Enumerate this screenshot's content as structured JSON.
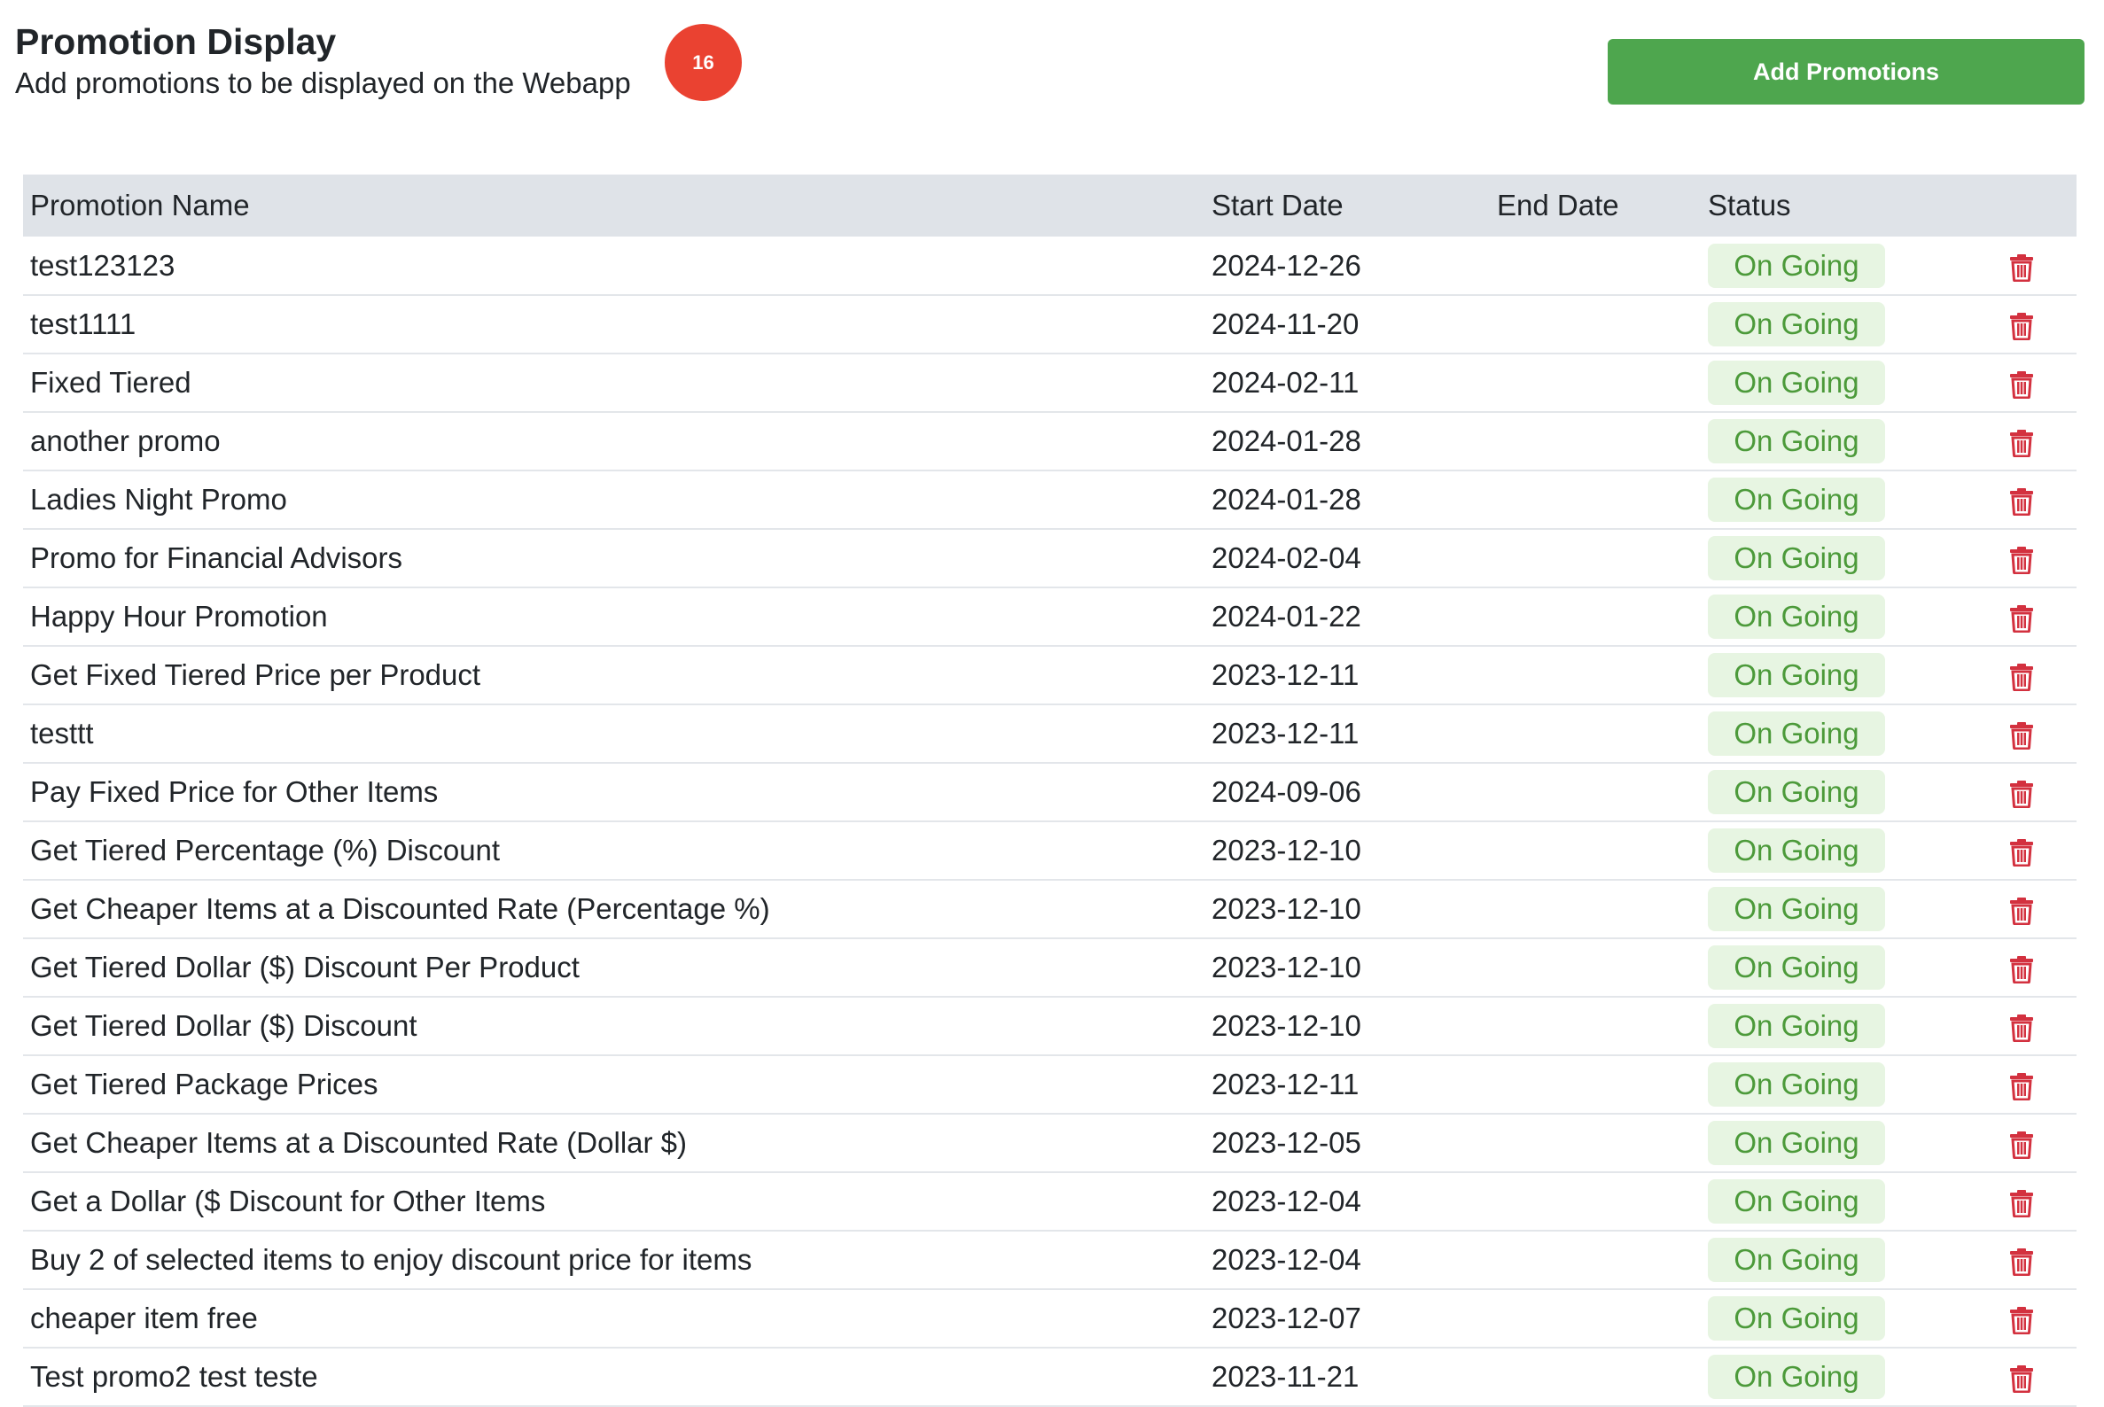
{
  "header": {
    "title": "Promotion Display",
    "subtitle": "Add promotions to be displayed on the Webapp",
    "count": "16",
    "add_button_label": "Add Promotions"
  },
  "colors": {
    "badge": "#ea4231",
    "add_button": "#4ea64e",
    "status_text": "#4c9a3a",
    "status_bg": "#e7f5e2",
    "trash": "#d3313f",
    "header_bg": "#dfe3e8"
  },
  "table": {
    "columns": [
      "Promotion Name",
      "Start Date",
      "End Date",
      "Status"
    ],
    "rows": [
      {
        "name": "test123123",
        "start": "2024-12-26",
        "end": "",
        "status": "On Going"
      },
      {
        "name": "test1111",
        "start": "2024-11-20",
        "end": "",
        "status": "On Going"
      },
      {
        "name": "Fixed Tiered",
        "start": "2024-02-11",
        "end": "",
        "status": "On Going"
      },
      {
        "name": "another promo",
        "start": "2024-01-28",
        "end": "",
        "status": "On Going"
      },
      {
        "name": "Ladies Night Promo",
        "start": "2024-01-28",
        "end": "",
        "status": "On Going"
      },
      {
        "name": "Promo for Financial Advisors",
        "start": "2024-02-04",
        "end": "",
        "status": "On Going"
      },
      {
        "name": "Happy Hour Promotion",
        "start": "2024-01-22",
        "end": "",
        "status": "On Going"
      },
      {
        "name": "Get Fixed Tiered Price per Product",
        "start": "2023-12-11",
        "end": "",
        "status": "On Going"
      },
      {
        "name": "testtt",
        "start": "2023-12-11",
        "end": "",
        "status": "On Going"
      },
      {
        "name": "Pay Fixed Price for Other Items",
        "start": "2024-09-06",
        "end": "",
        "status": "On Going"
      },
      {
        "name": "Get Tiered Percentage (%) Discount",
        "start": "2023-12-10",
        "end": "",
        "status": "On Going"
      },
      {
        "name": "Get Cheaper Items at a Discounted Rate (Percentage %)",
        "start": "2023-12-10",
        "end": "",
        "status": "On Going"
      },
      {
        "name": "Get Tiered Dollar ($) Discount Per Product",
        "start": "2023-12-10",
        "end": "",
        "status": "On Going"
      },
      {
        "name": "Get Tiered Dollar ($) Discount",
        "start": "2023-12-10",
        "end": "",
        "status": "On Going"
      },
      {
        "name": "Get Tiered Package Prices",
        "start": "2023-12-11",
        "end": "",
        "status": "On Going"
      },
      {
        "name": "Get Cheaper Items at a Discounted Rate (Dollar $)",
        "start": "2023-12-05",
        "end": "",
        "status": "On Going"
      },
      {
        "name": "Get a Dollar ($ Discount for Other Items",
        "start": "2023-12-04",
        "end": "",
        "status": "On Going"
      },
      {
        "name": "Buy 2 of selected items to enjoy discount price for items",
        "start": "2023-12-04",
        "end": "",
        "status": "On Going"
      },
      {
        "name": "cheaper item free",
        "start": "2023-12-07",
        "end": "",
        "status": "On Going"
      },
      {
        "name": "Test promo2 test teste",
        "start": "2023-11-21",
        "end": "",
        "status": "On Going"
      }
    ],
    "row_action_icon": "trash-icon"
  }
}
